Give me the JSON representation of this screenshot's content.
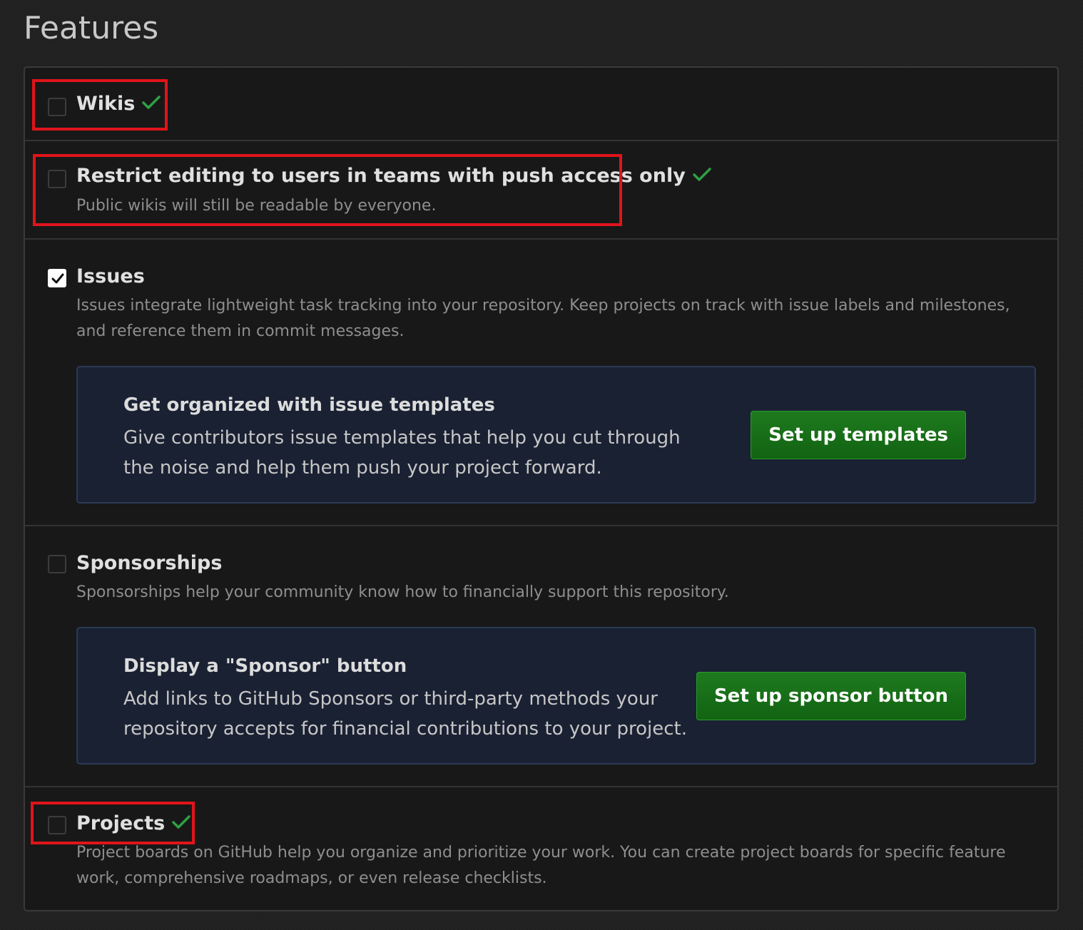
{
  "page": {
    "title": "Features"
  },
  "features": {
    "wikis": {
      "label": "Wikis",
      "checked": false
    },
    "restrict_editing": {
      "label": "Restrict editing to users in teams with push access only",
      "description": "Public wikis will still be readable by everyone.",
      "checked": false
    },
    "issues": {
      "label": "Issues",
      "description": "Issues integrate lightweight task tracking into your repository. Keep projects on track with issue labels and milestones, and reference them in commit messages.",
      "checked": true,
      "promo": {
        "title": "Get organized with issue templates",
        "description": "Give contributors issue templates that help you cut through the noise and help them push your project forward.",
        "button_label": "Set up templates"
      }
    },
    "sponsorships": {
      "label": "Sponsorships",
      "description": "Sponsorships help your community know how to financially support this repository.",
      "checked": false,
      "promo": {
        "title": "Display a \"Sponsor\" button",
        "description": "Add links to GitHub Sponsors or third-party methods your repository accepts for financial contributions to your project.",
        "button_label": "Set up sponsor button"
      }
    },
    "projects": {
      "label": "Projects",
      "description": "Project boards on GitHub help you organize and prioritize your work. You can create project boards for specific feature work, comprehensive roadmaps, or even release checklists.",
      "checked": false
    }
  },
  "colors": {
    "success_check": "#2ea043",
    "highlight_border": "#e0141a",
    "primary_button": "#1e7a1e",
    "promo_background": "#1a2133"
  },
  "icons": {
    "success": "check-icon",
    "checkbox_mark": "checkmark-icon"
  }
}
